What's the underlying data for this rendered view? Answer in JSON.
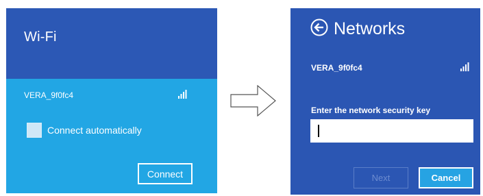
{
  "left": {
    "title": "Wi-Fi",
    "network_name": "VERA_9f0fc4",
    "connect_auto_label": "Connect automatically",
    "connect_label": "Connect"
  },
  "arrow": {
    "icon": "arrow-right-icon"
  },
  "right": {
    "title": "Networks",
    "back_icon": "back-arrow-icon",
    "network_name": "VERA_9f0fc4",
    "key_label": "Enter the network security key",
    "key_value": "",
    "next_label": "Next",
    "cancel_label": "Cancel"
  },
  "colors": {
    "header_blue": "#2c58b5",
    "body_cyan": "#22a6e4",
    "right_blue": "#2b56b3",
    "accent_button": "#26a3e3"
  }
}
